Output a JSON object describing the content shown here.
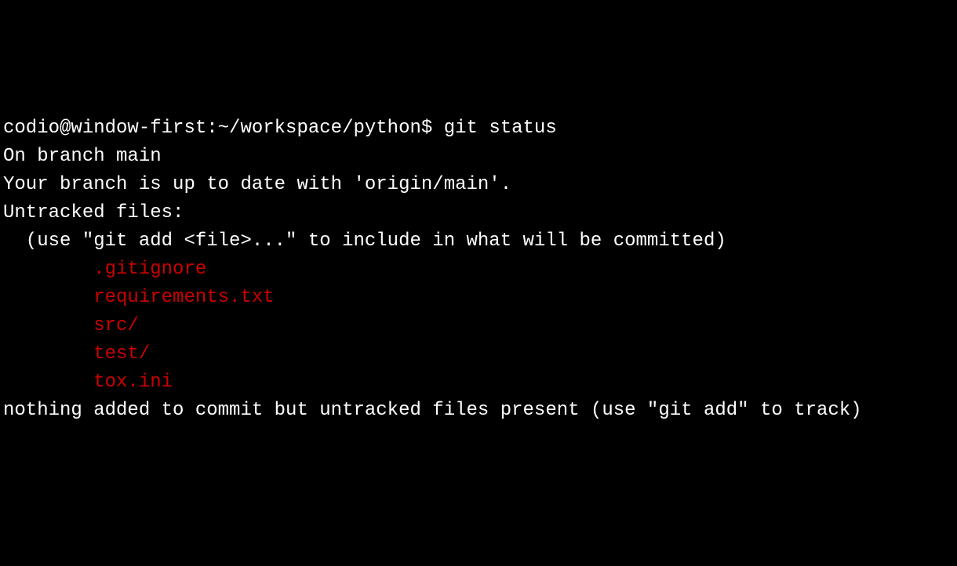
{
  "prompt": "codio@window-first:~/workspace/python$ ",
  "command": "git status",
  "output": {
    "branch_line": "On branch main",
    "upstream_line": "Your branch is up to date with 'origin/main'.",
    "blank1": "",
    "untracked_header": "Untracked files:",
    "untracked_hint": "  (use \"git add <file>...\" to include in what will be committed)",
    "blank2": "",
    "untracked_files": [
      ".gitignore",
      "requirements.txt",
      "src/",
      "test/",
      "tox.ini"
    ],
    "blank3": "",
    "footer": "nothing added to commit but untracked files present (use \"git add\" to track)"
  },
  "untracked_indent": "        "
}
